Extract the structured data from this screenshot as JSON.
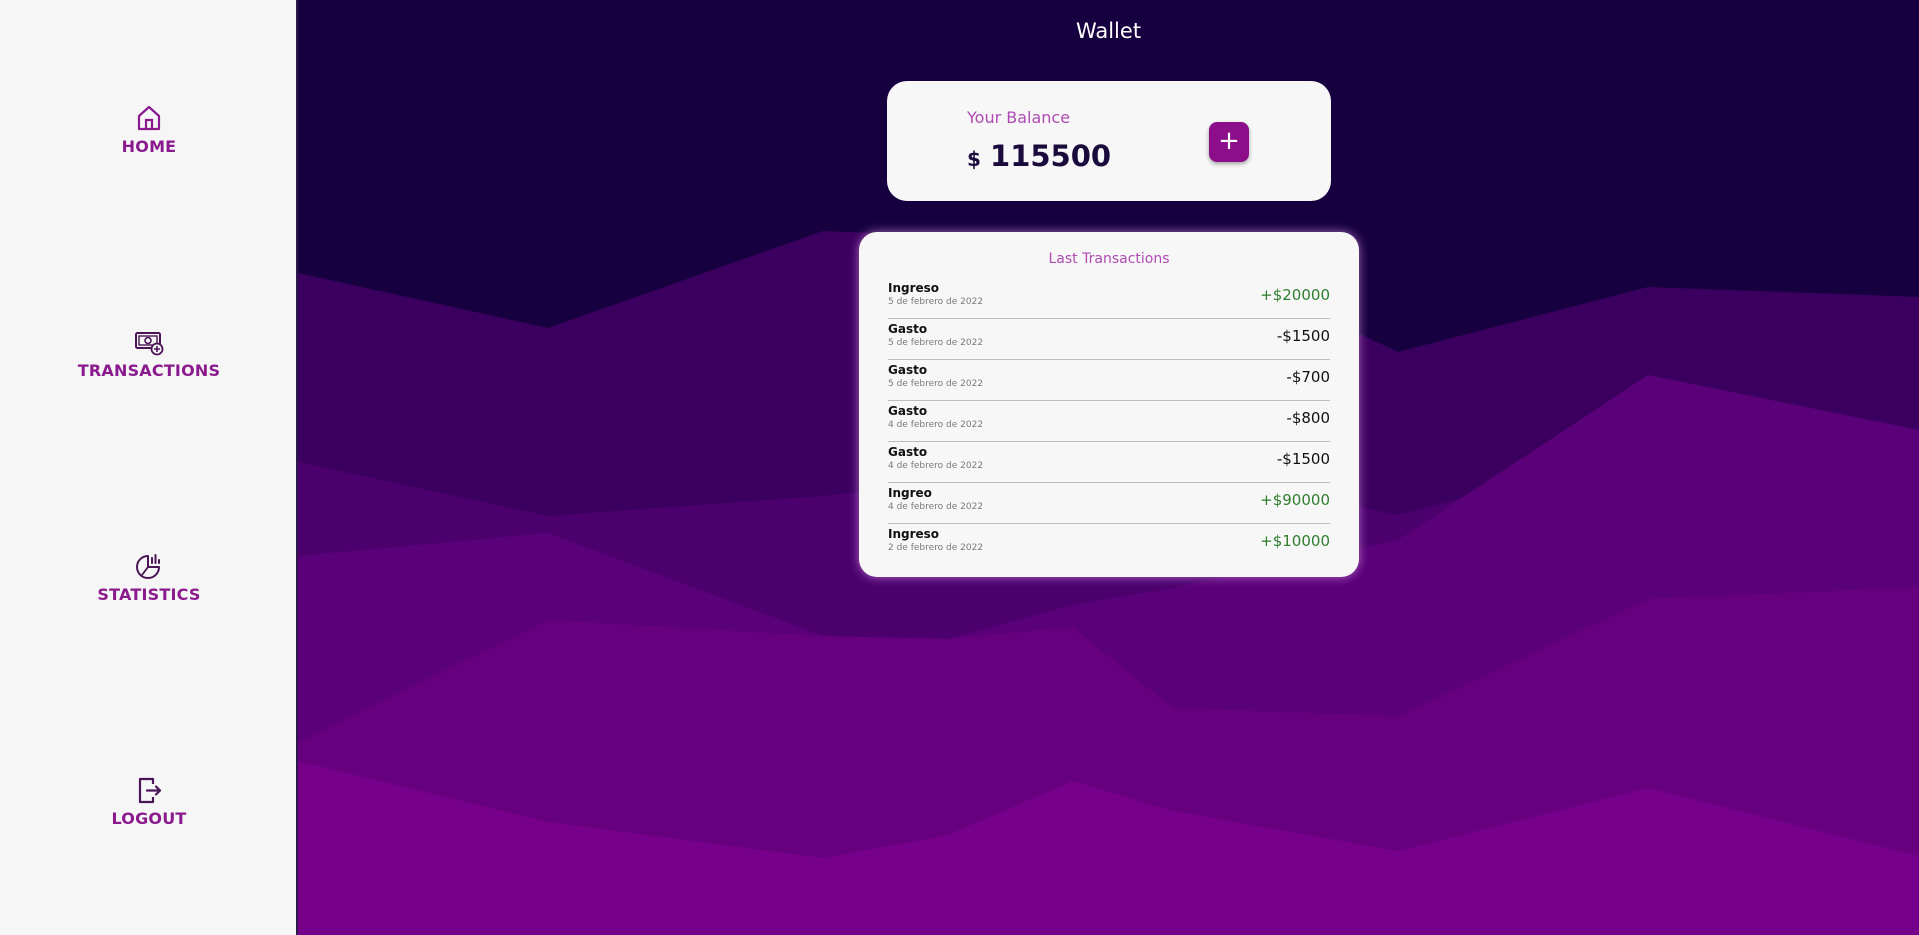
{
  "sidebar": {
    "items": [
      {
        "label": "HOME",
        "icon": "home-icon"
      },
      {
        "label": "TRANSACTIONS",
        "icon": "money-plus-icon"
      },
      {
        "label": "STATISTICS",
        "icon": "pie-chart-icon"
      },
      {
        "label": "LOGOUT",
        "icon": "logout-icon"
      }
    ]
  },
  "header": {
    "title": "Wallet"
  },
  "balance": {
    "label": "Your Balance",
    "currency": "$",
    "amount": "115500",
    "add_label": "+"
  },
  "transactions": {
    "title": "Last Transactions",
    "rows": [
      {
        "type": "Ingreso",
        "date": "5 de febrero de 2022",
        "amount": "+$20000"
      },
      {
        "type": "Gasto",
        "date": "5 de febrero de 2022",
        "amount": "-$1500"
      },
      {
        "type": "Gasto",
        "date": "5 de febrero de 2022",
        "amount": "-$700"
      },
      {
        "type": "Gasto",
        "date": "4 de febrero de 2022",
        "amount": "-$800"
      },
      {
        "type": "Gasto",
        "date": "4 de febrero de 2022",
        "amount": "-$1500"
      },
      {
        "type": "Ingreo",
        "date": "4 de febrero de 2022",
        "amount": "+$90000"
      },
      {
        "type": "Ingreso",
        "date": "2 de febrero de 2022",
        "amount": "+$10000"
      }
    ]
  },
  "colors": {
    "accent": "#8c0e8a",
    "sidebar_bg": "#f6f6f6",
    "page_bg": "#160040",
    "positive": "#2e7d2e"
  }
}
